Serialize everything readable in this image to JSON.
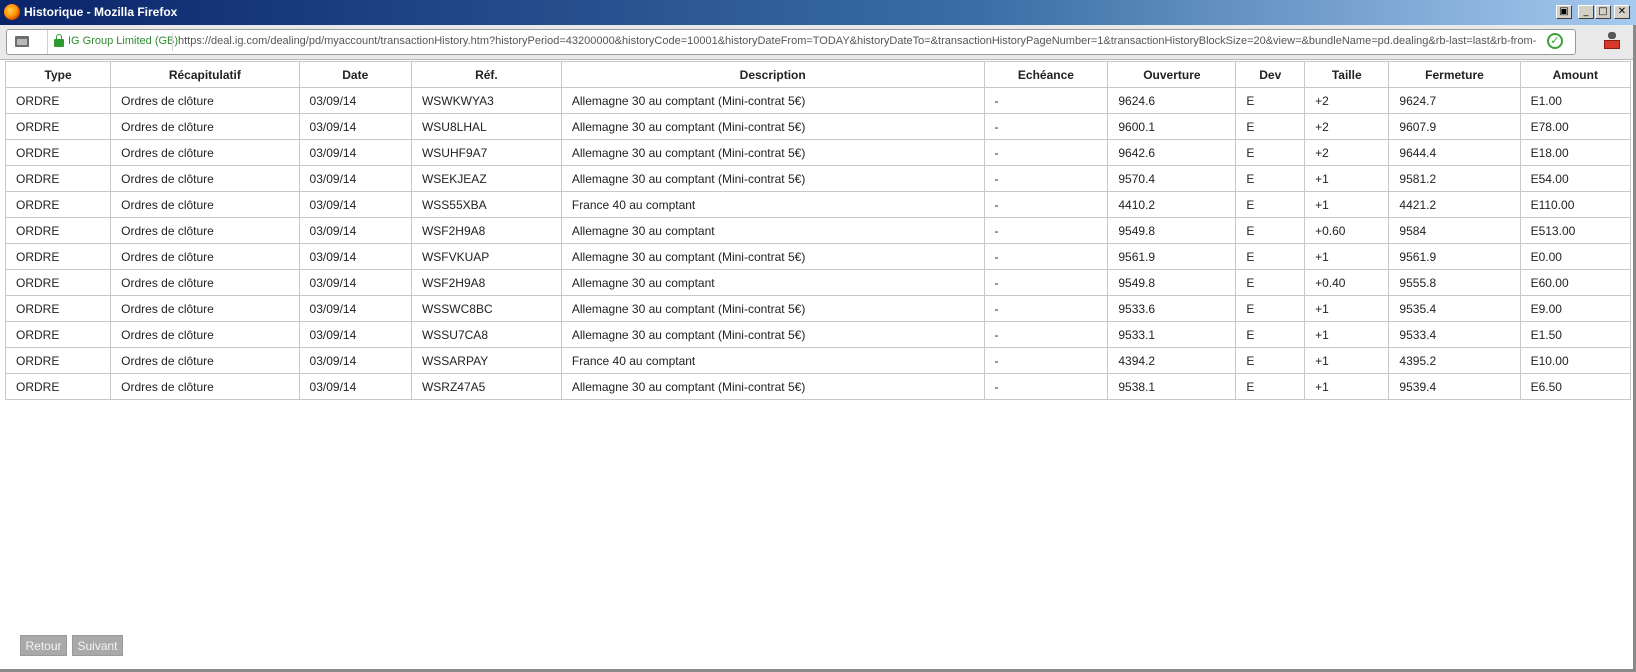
{
  "window": {
    "title": "Historique - Mozilla Firefox",
    "buttons": {
      "restore": "▣",
      "minimize": "_",
      "maximize": "□",
      "close": "✕"
    }
  },
  "navbar": {
    "identity": "IG Group Limited (GB)",
    "url": "https://deal.ig.com/dealing/pd/myaccount/transactionHistory.htm?historyPeriod=43200000&historyCode=10001&historyDateFrom=TODAY&historyDateTo=&transactionHistoryPageNumber=1&transactionHistoryBlockSize=20&view=&bundleName=pd.dealing&rb-last=last&rb-from-to=fror",
    "check_glyph": "✓"
  },
  "table": {
    "columns": [
      "Type",
      "Récapitulatif",
      "Date",
      "Réf.",
      "Description",
      "Echéance",
      "Ouverture",
      "Dev",
      "Taille",
      "Fermeture",
      "Amount"
    ],
    "rows": [
      [
        "ORDRE",
        "Ordres de clôture",
        "03/09/14",
        "WSWKWYA3",
        "Allemagne 30 au comptant (Mini-contrat 5€)",
        "-",
        "9624.6",
        "E",
        "+2",
        "9624.7",
        "E1.00"
      ],
      [
        "ORDRE",
        "Ordres de clôture",
        "03/09/14",
        "WSU8LHAL",
        "Allemagne 30 au comptant (Mini-contrat 5€)",
        "-",
        "9600.1",
        "E",
        "+2",
        "9607.9",
        "E78.00"
      ],
      [
        "ORDRE",
        "Ordres de clôture",
        "03/09/14",
        "WSUHF9A7",
        "Allemagne 30 au comptant (Mini-contrat 5€)",
        "-",
        "9642.6",
        "E",
        "+2",
        "9644.4",
        "E18.00"
      ],
      [
        "ORDRE",
        "Ordres de clôture",
        "03/09/14",
        "WSEKJEAZ",
        "Allemagne 30 au comptant (Mini-contrat 5€)",
        "-",
        "9570.4",
        "E",
        "+1",
        "9581.2",
        "E54.00"
      ],
      [
        "ORDRE",
        "Ordres de clôture",
        "03/09/14",
        "WSS55XBA",
        "France 40 au comptant",
        "-",
        "4410.2",
        "E",
        "+1",
        "4421.2",
        "E110.00"
      ],
      [
        "ORDRE",
        "Ordres de clôture",
        "03/09/14",
        "WSF2H9A8",
        "Allemagne 30 au comptant",
        "-",
        "9549.8",
        "E",
        "+0.60",
        "9584",
        "E513.00"
      ],
      [
        "ORDRE",
        "Ordres de clôture",
        "03/09/14",
        "WSFVKUAP",
        "Allemagne 30 au comptant (Mini-contrat 5€)",
        "-",
        "9561.9",
        "E",
        "+1",
        "9561.9",
        "E0.00"
      ],
      [
        "ORDRE",
        "Ordres de clôture",
        "03/09/14",
        "WSF2H9A8",
        "Allemagne 30 au comptant",
        "-",
        "9549.8",
        "E",
        "+0.40",
        "9555.8",
        "E60.00"
      ],
      [
        "ORDRE",
        "Ordres de clôture",
        "03/09/14",
        "WSSWC8BC",
        "Allemagne 30 au comptant (Mini-contrat 5€)",
        "-",
        "9533.6",
        "E",
        "+1",
        "9535.4",
        "E9.00"
      ],
      [
        "ORDRE",
        "Ordres de clôture",
        "03/09/14",
        "WSSU7CA8",
        "Allemagne 30 au comptant (Mini-contrat 5€)",
        "-",
        "9533.1",
        "E",
        "+1",
        "9533.4",
        "E1.50"
      ],
      [
        "ORDRE",
        "Ordres de clôture",
        "03/09/14",
        "WSSARPAY",
        "France 40 au comptant",
        "-",
        "4394.2",
        "E",
        "+1",
        "4395.2",
        "E10.00"
      ],
      [
        "ORDRE",
        "Ordres de clôture",
        "03/09/14",
        "WSRZ47A5",
        "Allemagne 30 au comptant (Mini-contrat 5€)",
        "-",
        "9538.1",
        "E",
        "+1",
        "9539.4",
        "E6.50"
      ]
    ]
  },
  "pagination": {
    "back_label": "Retour",
    "next_label": "Suivant"
  }
}
